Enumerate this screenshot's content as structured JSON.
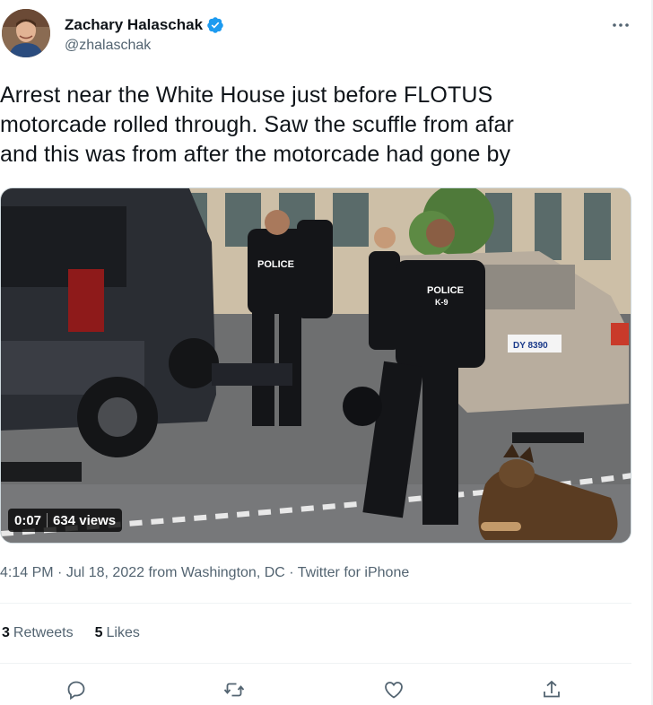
{
  "author": {
    "name": "Zachary Halaschak",
    "handle": "@zhalaschak",
    "verified": true
  },
  "tweet": {
    "text_lines": [
      "Arrest near the White House just before FLOTUS",
      "motorcade rolled through. Saw the scuffle from afar",
      "and this was from after the motorcade had gone by"
    ]
  },
  "media": {
    "duration": "0:07",
    "views": "634 views",
    "scene_text": {
      "vest_left": "POLICE",
      "vest_right": "POLICE",
      "vest_right_sub": "K-9",
      "plate": "DY 8390"
    }
  },
  "meta": {
    "time": "4:14 PM",
    "date": "Jul 18, 2022",
    "from": "from Washington, DC",
    "source": "Twitter for iPhone",
    "dot": "·"
  },
  "stats": {
    "retweets_count": "3",
    "retweets_label": "Retweets",
    "likes_count": "5",
    "likes_label": "Likes"
  },
  "actions": [
    "reply-icon",
    "retweet-icon",
    "like-icon",
    "share-icon"
  ],
  "colors": {
    "accent": "#1d9bf0",
    "text": "#0f1419",
    "secondary": "#536471",
    "divider": "#eff3f4"
  }
}
